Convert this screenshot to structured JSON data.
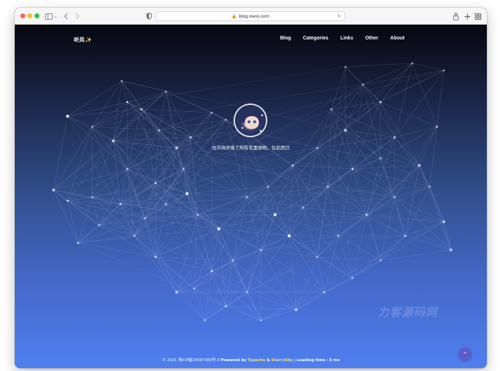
{
  "browser": {
    "url": "blog.owoii.com"
  },
  "site": {
    "brand": "听风",
    "brand_emoji": "✨",
    "nav": [
      {
        "label": "Blog"
      },
      {
        "label": "Categories"
      },
      {
        "label": "Links"
      },
      {
        "label": "Other"
      },
      {
        "label": "About"
      }
    ],
    "motto": "也许你厌倦了所有花里胡哨，仅此而已",
    "footer": {
      "copyright": "© 2021",
      "icp": "粤ICP备19097300号-3",
      "powered_by": "Powered by",
      "typecho": "Typecho",
      "amp": "&",
      "theme": "StarrySky",
      "separator": "|",
      "loading_label": "Loading time",
      "loading_value": "5 ms"
    },
    "watermark": "力客源码网"
  },
  "icons": {
    "sidebar": "sidebar-icon",
    "back": "chevron-left-icon",
    "forward": "chevron-right-icon",
    "shield": "shield-icon",
    "lock": "lock-icon",
    "reload": "reload-icon",
    "share": "share-icon",
    "new_tab": "plus-icon",
    "tabs": "tabs-overview-icon",
    "scroll_top": "arrow-up-icon"
  },
  "colors": {
    "traffic_red": "#fe5f57",
    "traffic_yellow": "#febc2e",
    "traffic_green": "#28c840",
    "gradient_top": "#05070f",
    "gradient_bottom": "#4f7ff0",
    "scroll_button": "#5e5cc8",
    "footer_link": "#f5e27a"
  }
}
